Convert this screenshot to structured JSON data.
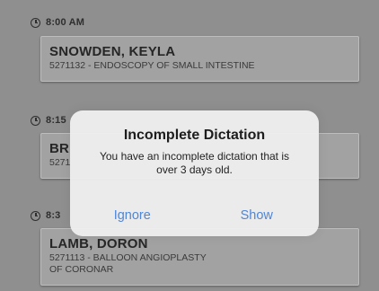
{
  "appointments": [
    {
      "time": "8:00 AM",
      "name": "SNOWDEN, KEYLA",
      "procedure": "5271132 - ENDOSCOPY OF SMALL INTESTINE"
    },
    {
      "time": "8:15",
      "name": "BR",
      "procedure": "5271"
    },
    {
      "time": "8:3",
      "name": "LAMB, DORON",
      "procedure_line1": "5271113 - BALLOON ANGIOPLASTY",
      "procedure_line2": "OF CORONAR"
    }
  ],
  "dialog": {
    "title": "Incomplete Dictation",
    "message": "You have an incomplete dictation that is over 3 days old.",
    "ignore_label": "Ignore",
    "show_label": "Show"
  },
  "colors": {
    "background": "#8f8f8f",
    "card": "#a2a2a2",
    "dialog_button": "#4f86d6"
  }
}
